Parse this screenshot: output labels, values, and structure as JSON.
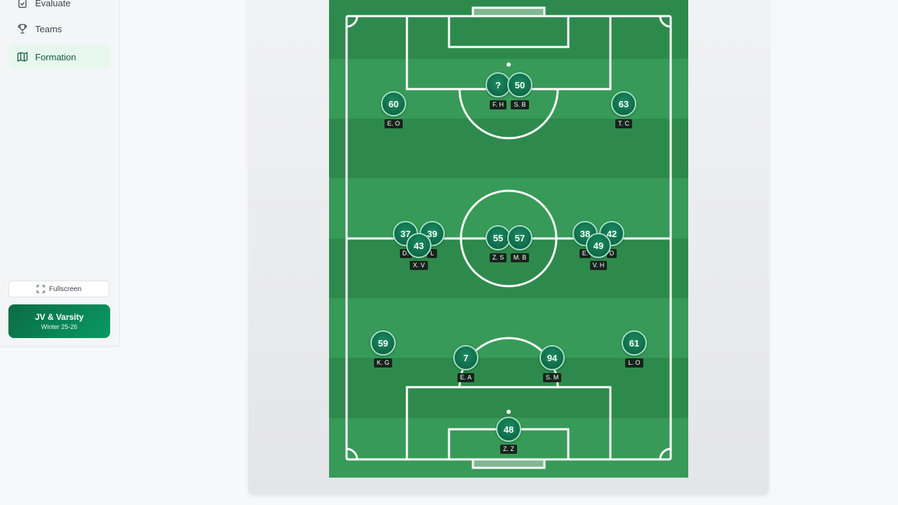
{
  "sidebar": {
    "items": [
      {
        "label": "Evaluate",
        "icon": "clipboard-check-icon"
      },
      {
        "label": "Teams",
        "icon": "trophy-icon"
      },
      {
        "label": "Formation",
        "icon": "map-icon",
        "active": true
      }
    ],
    "fullscreen_label": "Fullscreen",
    "team_card": {
      "title": "JV & Varsity",
      "season": "Winter 25-26"
    }
  },
  "colors": {
    "accent": "#0b6b45",
    "pitch_dark": "#2e8a4c",
    "pitch_light": "#389a58",
    "marker": "#0c5c3f"
  },
  "players": [
    {
      "number": "?",
      "label": "F. H"
    },
    {
      "number": "50",
      "label": "S. B"
    },
    {
      "number": "60",
      "label": "E. O"
    },
    {
      "number": "63",
      "label": "T. C"
    },
    {
      "number": "37",
      "label": "D."
    },
    {
      "number": "39",
      "label": "L"
    },
    {
      "number": "43",
      "label": "X. V"
    },
    {
      "number": "55",
      "label": "Z. S"
    },
    {
      "number": "57",
      "label": "M. B"
    },
    {
      "number": "38",
      "label": "E."
    },
    {
      "number": "42",
      "label": "D"
    },
    {
      "number": "49",
      "label": "V. H"
    },
    {
      "number": "59",
      "label": "K. G"
    },
    {
      "number": "7",
      "label": "E. A"
    },
    {
      "number": "94",
      "label": "S. M"
    },
    {
      "number": "61",
      "label": "L. O"
    },
    {
      "number": "48",
      "label": "Z. Z"
    }
  ]
}
